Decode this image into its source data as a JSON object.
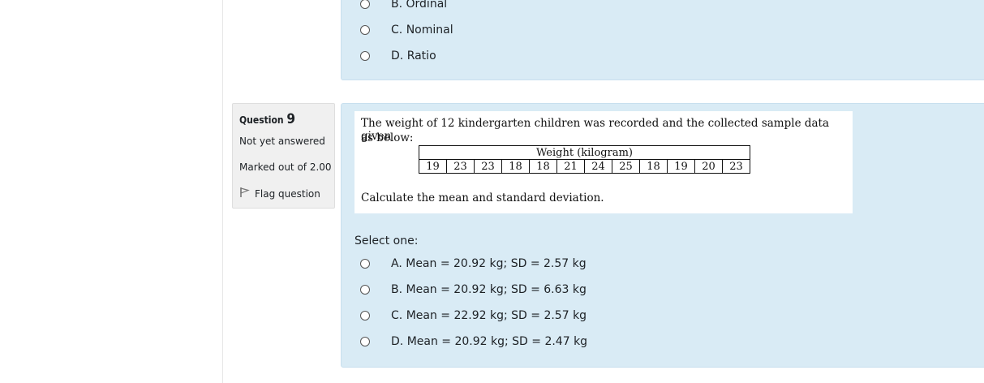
{
  "previous_question": {
    "options": [
      {
        "letter": "B.",
        "text": "Ordinal"
      },
      {
        "letter": "C.",
        "text": "Nominal"
      },
      {
        "letter": "D.",
        "text": "Ratio"
      }
    ]
  },
  "question": {
    "label": "Question",
    "number": "9",
    "state": "Not yet answered",
    "grade": "Marked out of 2.00",
    "flag_label": "Flag question",
    "text_line1": "The weight of 12 kindergarten children was recorded and the collected sample data given",
    "text_line2": "as below:",
    "table_header": "Weight (kilogram)",
    "weights": [
      "19",
      "23",
      "23",
      "18",
      "18",
      "21",
      "24",
      "25",
      "18",
      "19",
      "20",
      "23"
    ],
    "text_line3": "Calculate the mean and standard deviation.",
    "select_prompt": "Select one:",
    "options": [
      {
        "letter": "A.",
        "text": "Mean = 20.92 kg; SD = 2.57 kg"
      },
      {
        "letter": "B.",
        "text": "Mean = 20.92 kg; SD = 6.63 kg"
      },
      {
        "letter": "C.",
        "text": "Mean = 22.92 kg; SD = 2.57 kg"
      },
      {
        "letter": "D.",
        "text": "Mean = 20.92 kg; SD = 2.47 kg"
      }
    ]
  },
  "colors": {
    "panel_bg": "#d9ebf5",
    "info_bg": "#f0f0f0"
  }
}
